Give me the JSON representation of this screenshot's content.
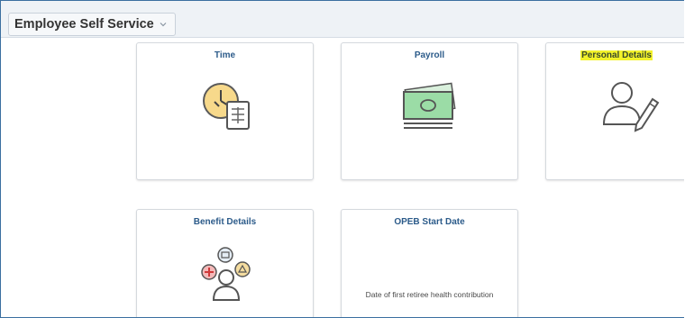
{
  "header": {
    "homepage_title": "Employee Self Service"
  },
  "tiles": [
    {
      "title": "Time",
      "icon": "clock-document-icon",
      "text": ""
    },
    {
      "title": "Payroll",
      "icon": "money-bills-icon",
      "text": ""
    },
    {
      "title": "Personal Details",
      "icon": "person-edit-icon",
      "text": "",
      "highlighted": true
    },
    {
      "title": "Benefit Details",
      "icon": "benefits-person-icon",
      "text": ""
    },
    {
      "title": "OPEB Start Date",
      "icon": "",
      "text": "Date of first retiree health contribution"
    }
  ],
  "colors": {
    "tile_title": "#2c5b8a",
    "highlight": "#f3f22a",
    "frame_border": "#3b6fa0",
    "header_bg": "#eef2f6"
  }
}
